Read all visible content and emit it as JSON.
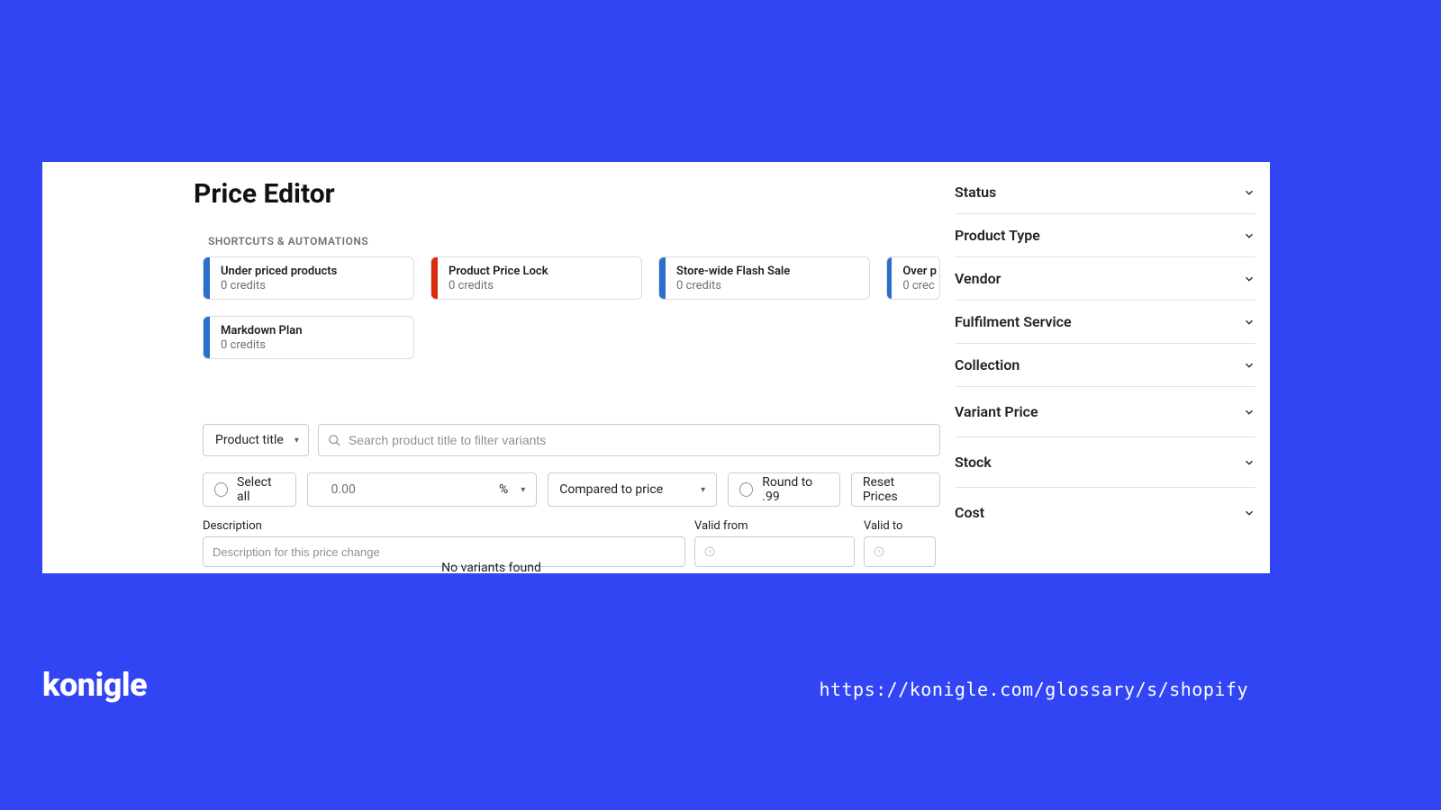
{
  "page": {
    "title": "Price Editor",
    "shortcuts_label": "SHORTCUTS & AUTOMATIONS",
    "no_variants": "No variants found"
  },
  "shortcuts": [
    {
      "title": "Under priced products",
      "sub": "0 credits",
      "color": "blue"
    },
    {
      "title": "Product Price Lock",
      "sub": "0 credits",
      "color": "red"
    },
    {
      "title": "Store-wide Flash Sale",
      "sub": "0 credits",
      "color": "blue"
    },
    {
      "title": "Over p",
      "sub": "0 crec",
      "color": "blue"
    },
    {
      "title": "Markdown Plan",
      "sub": "0 credits",
      "color": "blue"
    }
  ],
  "search": {
    "filter_field": "Product title",
    "placeholder": "Search product title to filter variants"
  },
  "actions": {
    "select_all": "Select all",
    "amount": "0.00",
    "unit": "%",
    "compare": "Compared to price",
    "round": "Round to .99",
    "reset": "Reset Prices"
  },
  "form": {
    "desc_label": "Description",
    "desc_placeholder": "Description for this price change",
    "valid_from": "Valid from",
    "valid_to": "Valid to"
  },
  "filters": [
    "Status",
    "Product Type",
    "Vendor",
    "Fulfilment Service",
    "Collection",
    "Variant Price",
    "Stock",
    "Cost"
  ],
  "footer": {
    "brand": "konigle",
    "url": "https://konigle.com/glossary/s/shopify"
  }
}
